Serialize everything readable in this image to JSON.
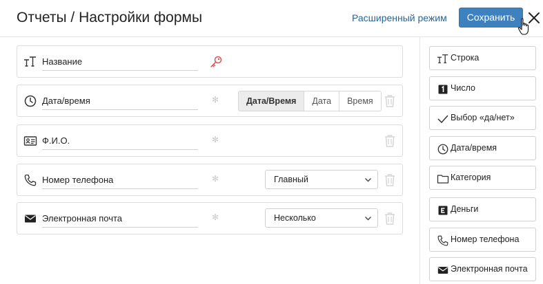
{
  "header": {
    "title": "Отчеты / Настройки формы",
    "advanced_mode": "Расширенный режим",
    "save_label": "Сохранить"
  },
  "fields": [
    {
      "name": "Название",
      "icon": "text-type-icon",
      "required": "key",
      "control": "none"
    },
    {
      "name": "Дата/время",
      "icon": "clock-icon",
      "control": "segmented",
      "options": [
        "Дата/Время",
        "Дата",
        "Время"
      ],
      "selected": "Дата/Время"
    },
    {
      "name": "Ф.И.О.",
      "icon": "id-card-icon",
      "control": "none"
    },
    {
      "name": "Номер телефона",
      "icon": "phone-icon",
      "control": "select",
      "value": "Главный"
    },
    {
      "name": "Электронная почта",
      "icon": "envelope-icon",
      "control": "select",
      "value": "Несколько"
    }
  ],
  "asterisk": "✻",
  "field_types": [
    {
      "label": "Строка",
      "icon": "text-type-icon"
    },
    {
      "label": "Число",
      "icon": "number-icon"
    },
    {
      "label": "Выбор «да/нет»",
      "icon": "checkmark-icon"
    },
    {
      "label": "Дата/время",
      "icon": "clock-icon"
    },
    {
      "label": "Категория",
      "icon": "folder-icon"
    },
    {
      "label": "Деньги",
      "icon": "money-icon"
    },
    {
      "label": "Номер телефона",
      "icon": "phone-icon"
    },
    {
      "label": "Электронная почта",
      "icon": "envelope-icon"
    }
  ],
  "colors": {
    "accent": "#3d82be",
    "link": "#2a6496",
    "key": "#d9534f"
  }
}
